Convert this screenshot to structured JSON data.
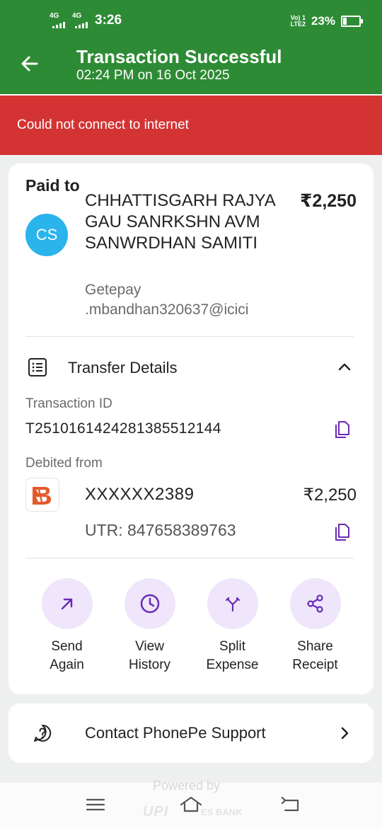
{
  "status_bar": {
    "sim1_type": "4G",
    "sim2_type": "4G",
    "time": "3:26",
    "volte_line1": "Vo) 1",
    "volte_line2": "LTE2",
    "battery": "23%"
  },
  "header": {
    "title": "Transaction Successful",
    "subtitle": "02:24 PM on 16 Oct 2025"
  },
  "offline_banner": {
    "message": "Could not connect to internet"
  },
  "payee": {
    "section_label": "Paid to",
    "initials": "CS",
    "avatar_color": "#2bb3ec",
    "name": "CHHATTISGARH RAJYA GAU SANRKSHN AVM SANWRDHAN SAMITI",
    "upi_line1": "Getepay",
    "upi_line2": ".mbandhan320637@icici",
    "amount": "₹2,250"
  },
  "transfer_details": {
    "label": "Transfer Details",
    "transaction_id_label": "Transaction ID",
    "transaction_id": "T2510161424281385512144",
    "debited_from_label": "Debited from",
    "account": "XXXXXX2389",
    "amount": "₹2,250",
    "utr": "UTR: 847658389763"
  },
  "actions": [
    {
      "line1": "Send",
      "line2": "Again",
      "icon": "arrow-up-right-icon"
    },
    {
      "line1": "View",
      "line2": "History",
      "icon": "clock-icon"
    },
    {
      "line1": "Split",
      "line2": "Expense",
      "icon": "split-icon"
    },
    {
      "line1": "Share",
      "line2": "Receipt",
      "icon": "share-icon"
    }
  ],
  "support": {
    "label": "Contact PhonePe Support"
  },
  "footer": {
    "powered_by": "Powered by",
    "upi": "UPI",
    "bank": "ES BANK"
  },
  "colors": {
    "brand_green": "#2e8b35",
    "error_red": "#d33333",
    "accent_purple": "#6a2bb5",
    "action_bg": "#efe6fb"
  }
}
